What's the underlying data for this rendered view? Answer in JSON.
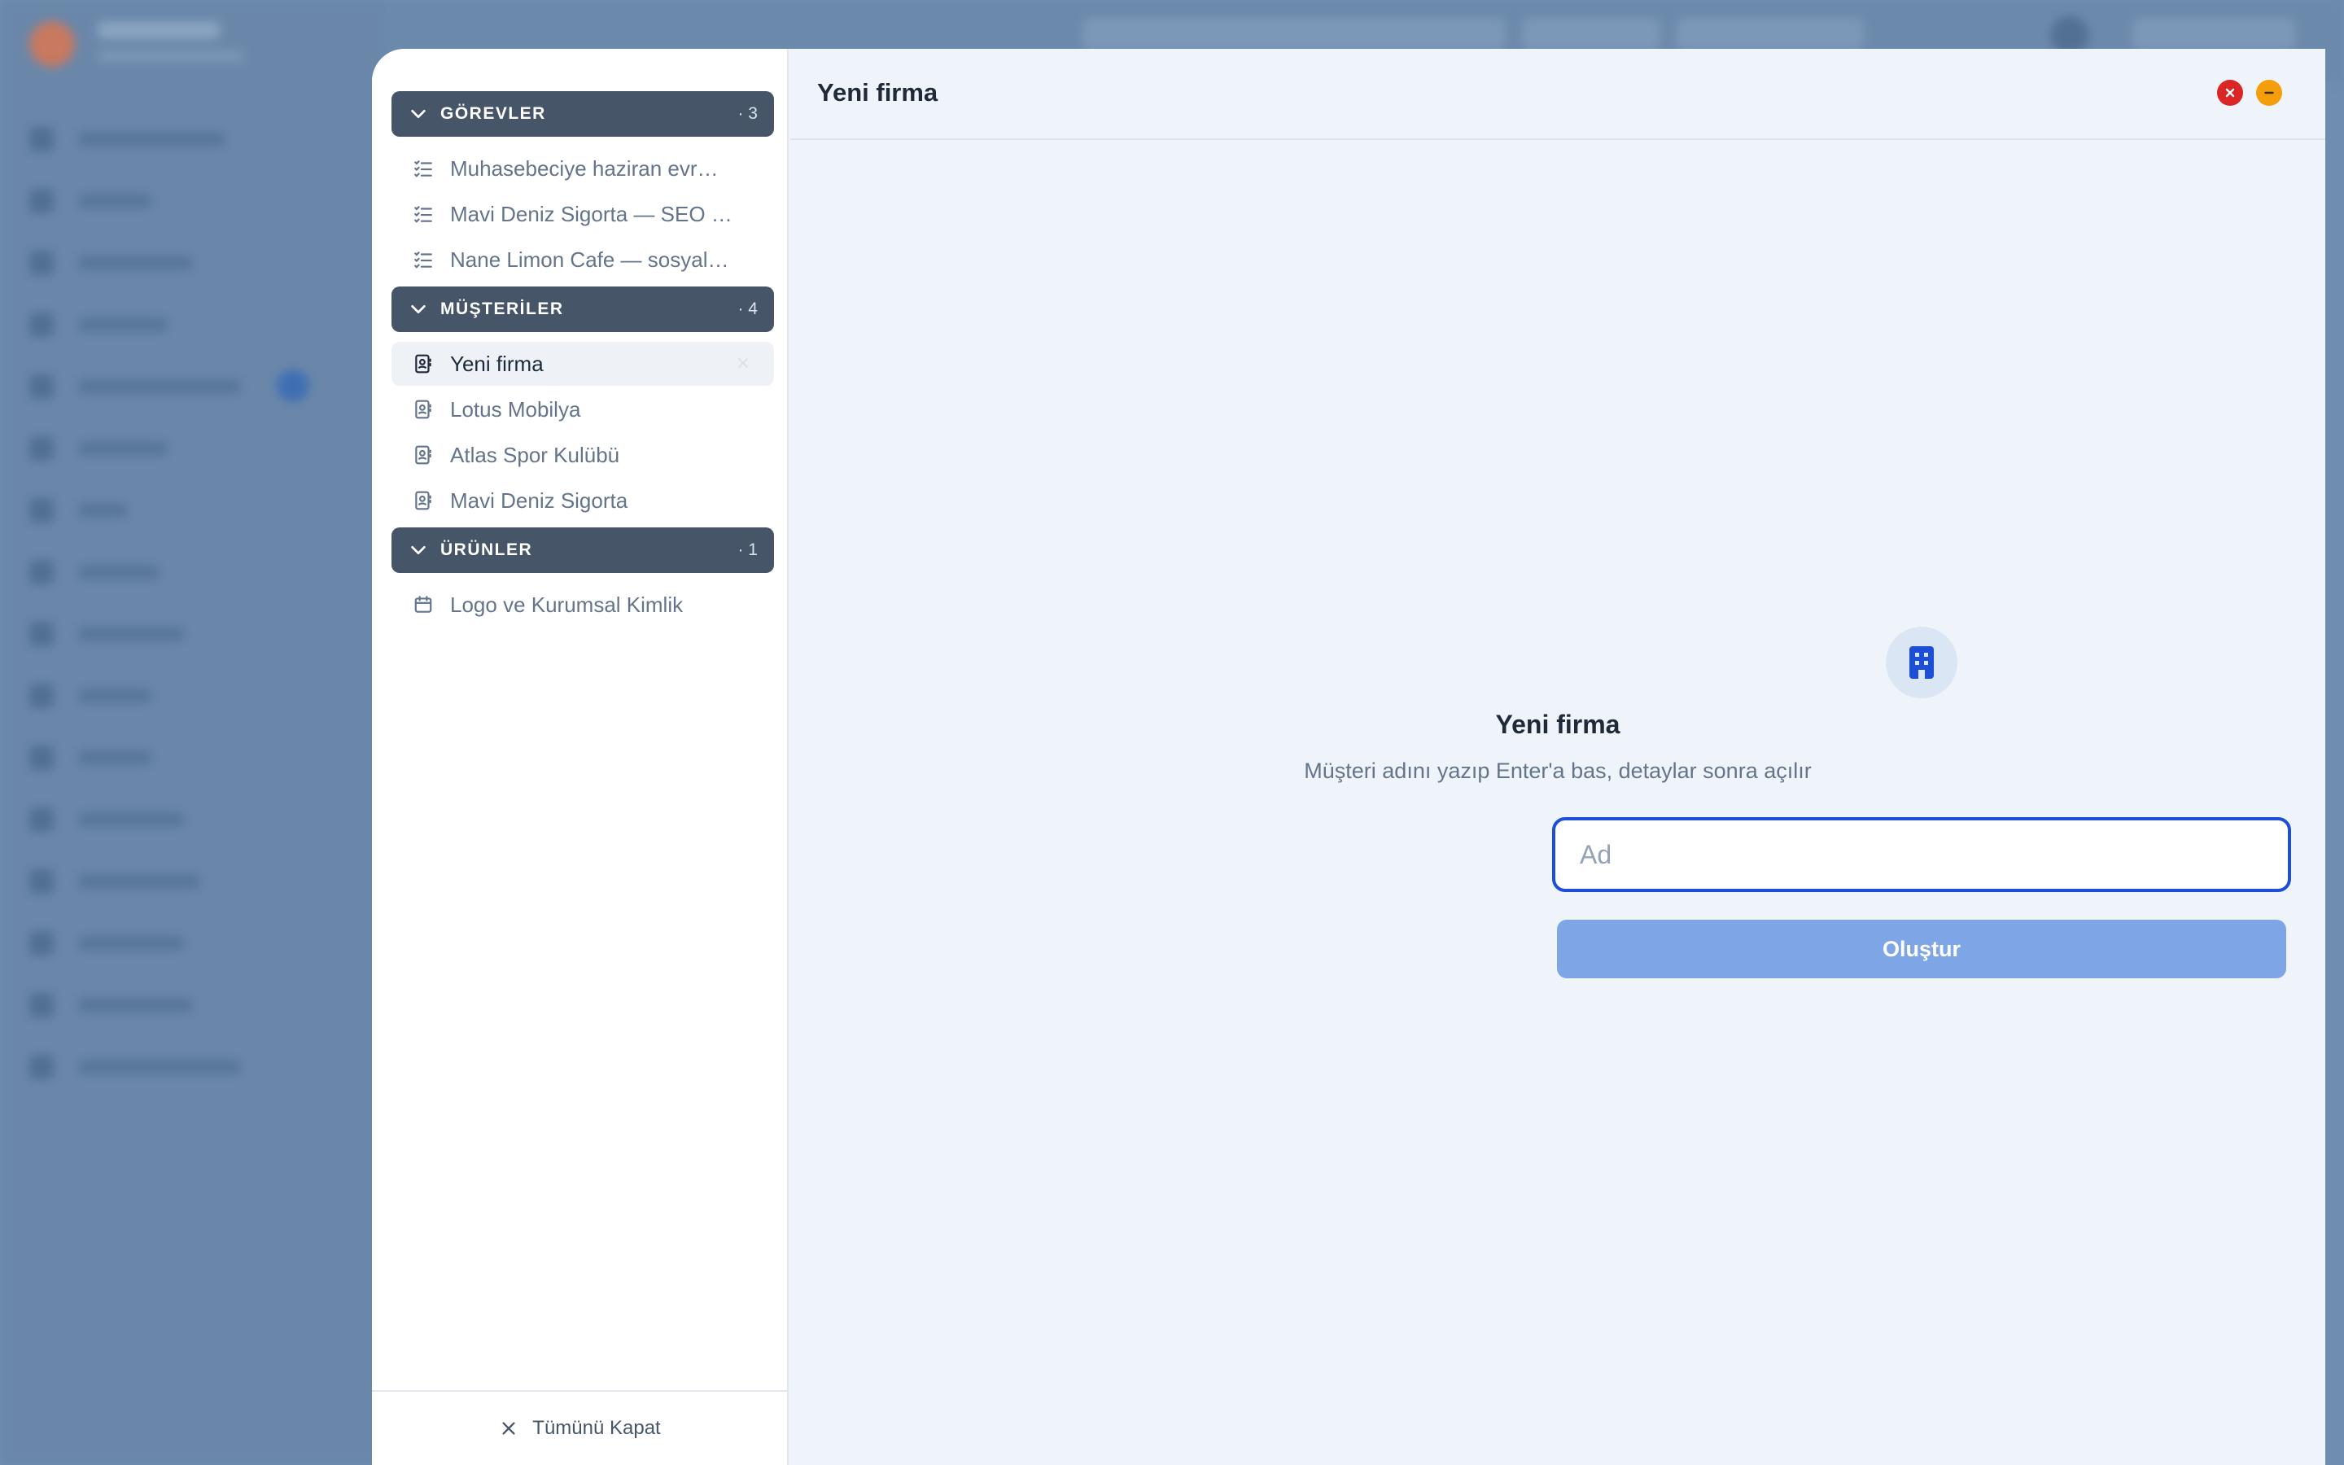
{
  "groups": [
    {
      "title": "GÖREVLER",
      "count": "· 3",
      "items": [
        {
          "label": "Muhasebeciye haziran evr…",
          "icon": "task-list-icon"
        },
        {
          "label": "Mavi Deniz Sigorta — SEO …",
          "icon": "task-list-icon"
        },
        {
          "label": "Nane Limon Cafe — sosyal…",
          "icon": "task-list-icon"
        }
      ]
    },
    {
      "title": "MÜŞTERİLER",
      "count": "· 4",
      "items": [
        {
          "label": "Yeni firma",
          "icon": "contact-card-icon",
          "active": true
        },
        {
          "label": "Lotus Mobilya",
          "icon": "contact-card-icon"
        },
        {
          "label": "Atlas Spor Kulübü",
          "icon": "contact-card-icon"
        },
        {
          "label": "Mavi Deniz Sigorta",
          "icon": "contact-card-icon"
        }
      ]
    },
    {
      "title": "ÜRÜNLER",
      "count": "· 1",
      "items": [
        {
          "label": "Logo ve Kurumsal Kimlik",
          "icon": "calendar-icon"
        }
      ]
    }
  ],
  "footer": {
    "close_all_label": "Tümünü Kapat"
  },
  "panel": {
    "title": "Yeni firma",
    "heading": "Yeni firma",
    "subtitle": "Müşteri adını yazıp Enter'a bas, detaylar sonra açılır",
    "input_placeholder": "Ad",
    "input_value": "",
    "create_label": "Oluştur"
  },
  "colors": {
    "accent": "#1d4ed8",
    "group_header": "#475569",
    "close_button": "#dc2626",
    "minimize_button": "#f59e0b",
    "create_button_disabled": "#7ea6e6"
  }
}
